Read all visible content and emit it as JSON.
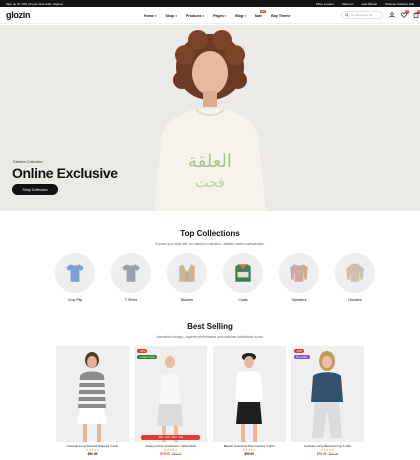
{
  "topbar": {
    "promo": "Sign up for 10% off your first order: Signup",
    "links": [
      "Store Locator",
      "About us",
      "Last Minute",
      "Summer Fashion Edit"
    ]
  },
  "header": {
    "logo": "glozin",
    "nav": [
      {
        "label": "Home",
        "chevron": true
      },
      {
        "label": "Shop",
        "chevron": true
      },
      {
        "label": "Products",
        "chevron": true
      },
      {
        "label": "Pages",
        "chevron": true
      },
      {
        "label": "Blog",
        "chevron": true
      },
      {
        "label": "Sale",
        "chevron": false,
        "badge": "Hot"
      },
      {
        "label": "Buy Theme",
        "chevron": false
      }
    ],
    "search_placeholder": "I'm shopping for...",
    "wishlist_count": "0",
    "cart_count": "0"
  },
  "hero": {
    "kicker": "Fashion Collection",
    "title": "Online Exclusive",
    "cta": "Shop Collection"
  },
  "collections": {
    "title": "Top Collections",
    "subtitle": "Express your style with our standout collection—fashion meets sophistication.",
    "items": [
      {
        "label": "Crop Flip",
        "icon": "shirt-icon",
        "color": "#7d9fcf"
      },
      {
        "label": "T-Shirts",
        "icon": "tshirt-icon",
        "color": "#9aa0a6"
      },
      {
        "label": "Blazers",
        "icon": "blazer-icon",
        "color": "#c7b59c"
      },
      {
        "label": "Coats",
        "icon": "coat-icon",
        "color": "#3f7f5a"
      },
      {
        "label": "Sweaters",
        "icon": "sweater-icon",
        "color": "#c9a9a0"
      },
      {
        "label": "Hoodies",
        "icon": "hoodie-icon",
        "color": "#cbbfae"
      }
    ]
  },
  "bestselling": {
    "title": "Best Selling",
    "subtitle": "Unmatched design—superior performance and customer satisfaction in one.",
    "products": [
      {
        "name": "Contrast Long Sleeved Stripped T-shirt",
        "price": "$90.00",
        "old_price": "",
        "tags": [],
        "countdown": "",
        "top_color": "#8c8c8c"
      },
      {
        "name": "Jersey Cutout Undershirt • Wide Neck",
        "price": "$75.00",
        "old_price": "$95.00",
        "tags": [
          {
            "text": "-18%",
            "color": "#e53935"
          },
          {
            "text": "Limited Stock",
            "color": "#2e7d32"
          }
        ],
        "countdown": "38d : 10h : 45m : 12s",
        "top_color": "#f4f4f4"
      },
      {
        "name": "Bleach Oversized Plus Contour T-shirt",
        "price": "$90.00",
        "old_price": "",
        "tags": [],
        "countdown": "",
        "top_color": "#ffffff"
      },
      {
        "name": "Contrast Long-Sleeved Crop T-shirt",
        "price": "$79.00",
        "old_price": "$98.00",
        "tags": [
          {
            "text": "-20%",
            "color": "#e53935"
          },
          {
            "text": "Pre-Order",
            "color": "#7e57c2"
          }
        ],
        "countdown": "",
        "top_color": "#35506b"
      }
    ],
    "stars": "★★★★★"
  }
}
